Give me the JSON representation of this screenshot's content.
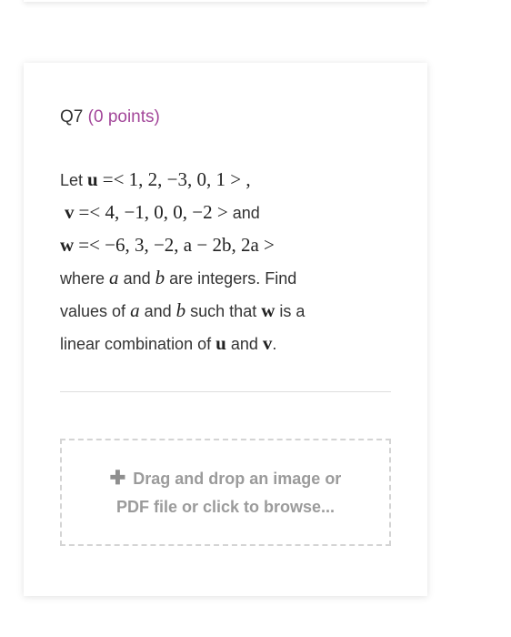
{
  "question": {
    "number": "Q7",
    "points": "(0 points)",
    "body": {
      "line1": {
        "let": "Let",
        "vec": "u",
        "expr": "=< 1, 2, −3, 0, 1 >  ,"
      },
      "line2": {
        "vec": "v",
        "expr": "=< 4, −1, 0, 0, −2 >",
        "tail": "and"
      },
      "line3": {
        "vec": "w",
        "expr": "=< −6, 3, −2, a − 2b, 2a >"
      },
      "line4": {
        "p1": "where",
        "a": "a",
        "p2": "and",
        "b": "b",
        "p3": "are integers. Find"
      },
      "line5": {
        "p1": "values of",
        "a": "a",
        "p2": "and",
        "b": "b",
        "p3": "such that",
        "w": "w",
        "p4": "is a"
      },
      "line6": {
        "p1": "linear combination of",
        "u": "u",
        "p2": "and",
        "v": "v",
        "p3": "."
      }
    }
  },
  "upload": {
    "icon": "plus-icon",
    "line1": "Drag and drop an image or",
    "line2": "PDF file or click to browse..."
  }
}
